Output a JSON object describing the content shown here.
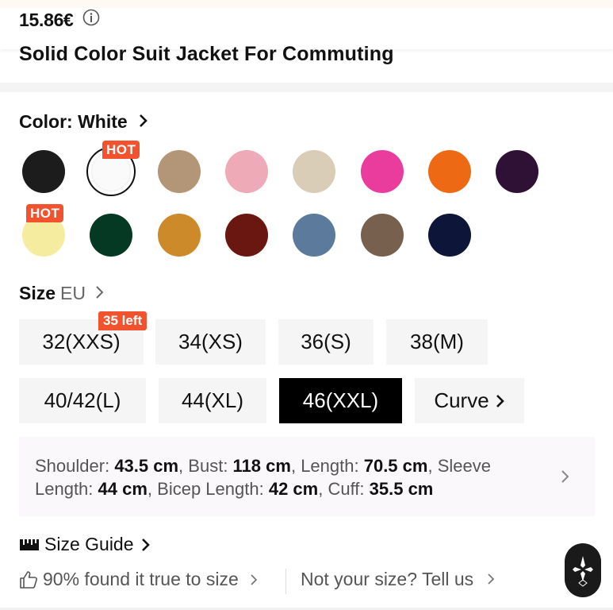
{
  "header": {
    "price": "15.86€",
    "title": "Solid Color Suit Jacket For Commuting"
  },
  "color": {
    "label": "Color: White",
    "hot_label": "HOT",
    "swatches": [
      {
        "name": "black",
        "hex": "#1b1c1b"
      },
      {
        "name": "white",
        "hex": "#fafafa",
        "selected": true,
        "hot": true
      },
      {
        "name": "tan",
        "hex": "#b39678"
      },
      {
        "name": "pink",
        "hex": "#eeaab7"
      },
      {
        "name": "beige",
        "hex": "#dacdb8"
      },
      {
        "name": "hot-pink",
        "hex": "#ea3c9d"
      },
      {
        "name": "orange",
        "hex": "#ed6913"
      },
      {
        "name": "plum",
        "hex": "#2f1136"
      },
      {
        "name": "pale-yellow",
        "hex": "#f6eca0",
        "hot": true
      },
      {
        "name": "dark-green",
        "hex": "#053923"
      },
      {
        "name": "mustard",
        "hex": "#cd8a2a"
      },
      {
        "name": "burgundy",
        "hex": "#6b1711"
      },
      {
        "name": "slate-blue",
        "hex": "#5b7a9c"
      },
      {
        "name": "brown",
        "hex": "#78604f"
      },
      {
        "name": "navy",
        "hex": "#0d1639"
      }
    ]
  },
  "size": {
    "label": "Size",
    "unit": "EU",
    "stock_badge": "35 left",
    "options": [
      "32(XXS)",
      "34(XS)",
      "36(S)",
      "38(M)",
      "40/42(L)",
      "44(XL)",
      "46(XXL)",
      "Curve"
    ],
    "selected": "46(XXL)"
  },
  "measurements": [
    {
      "label": "Shoulder",
      "value": "43.5 cm"
    },
    {
      "label": "Bust",
      "value": "118 cm"
    },
    {
      "label": "Length",
      "value": "70.5 cm"
    },
    {
      "label": "Sleeve Length",
      "value": "44 cm"
    },
    {
      "label": "Bicep Length",
      "value": "42 cm"
    },
    {
      "label": "Cuff",
      "value": "35.5 cm"
    }
  ],
  "size_guide": "Size Guide",
  "fit": {
    "true_to_size": "90% found it true to size",
    "feedback": "Not your size? Tell us"
  },
  "colors": {
    "accent": "#f2522d",
    "selected_bg": "#000000",
    "chip_bg": "#f5f5f5"
  }
}
